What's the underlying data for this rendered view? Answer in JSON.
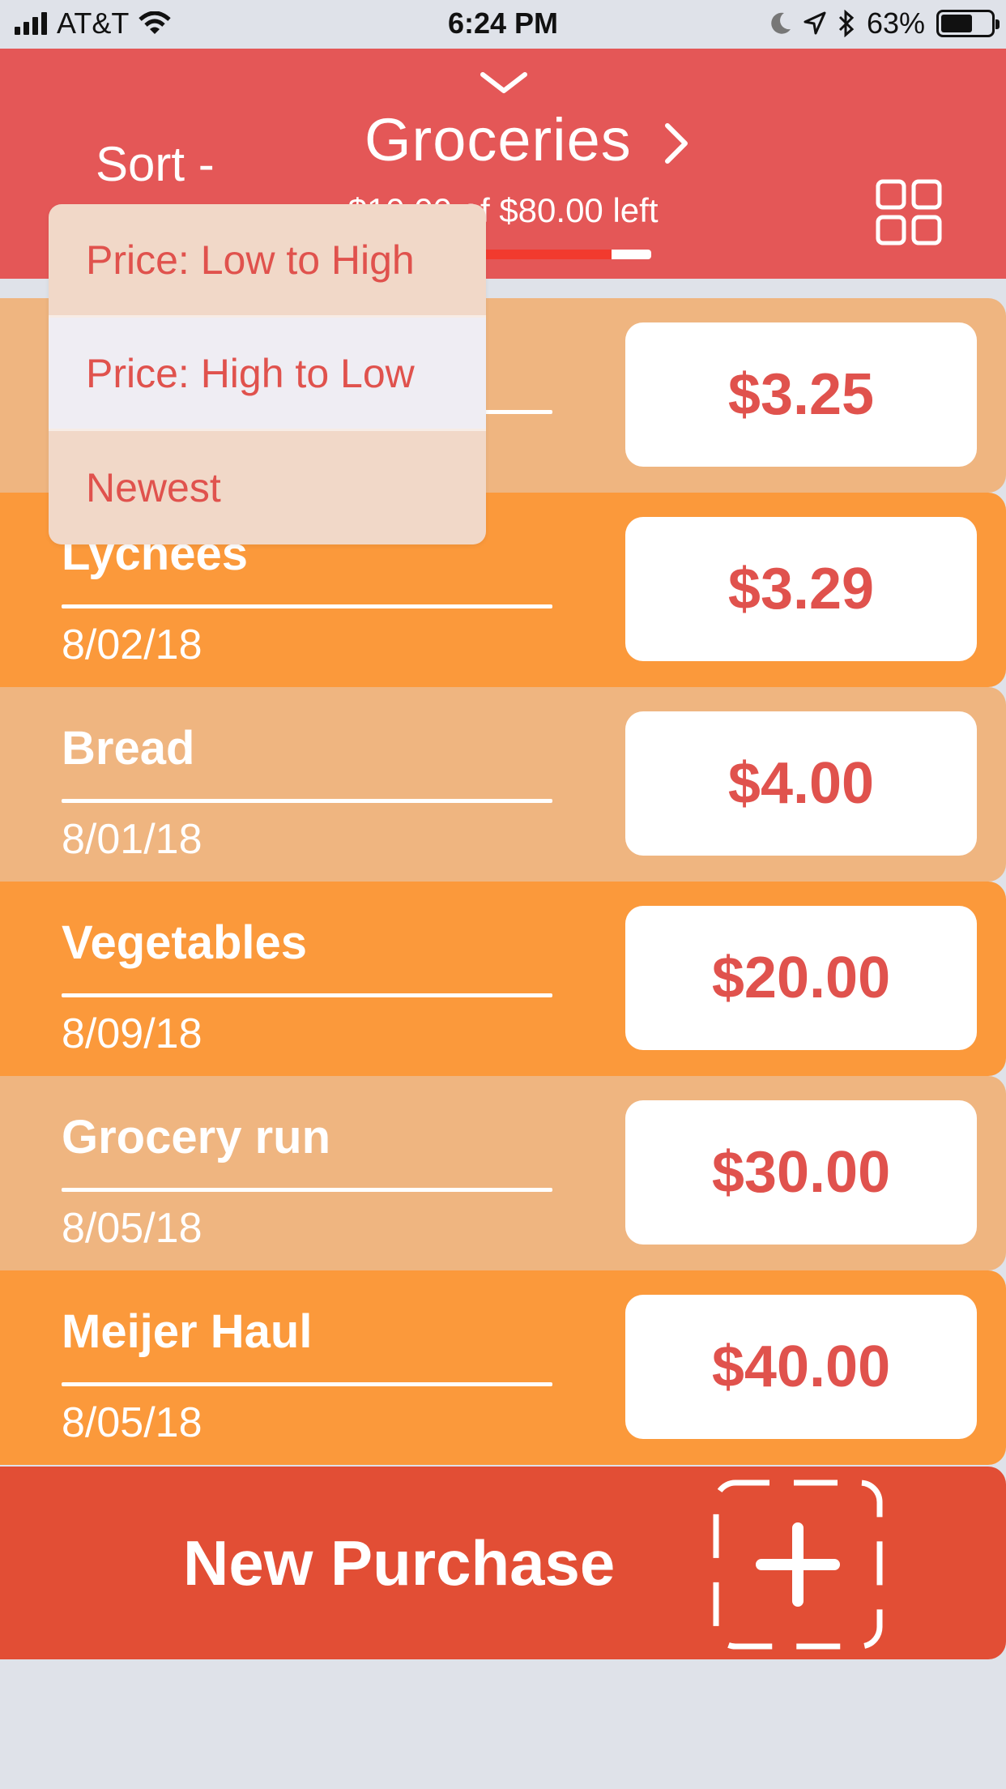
{
  "status_bar": {
    "carrier": "AT&T",
    "time": "6:24 PM",
    "battery_percent": "63%",
    "battery_level": 0.63,
    "icons": [
      "signal-icon",
      "wifi-icon",
      "moon-icon",
      "location-icon",
      "bluetooth-icon",
      "battery-icon"
    ]
  },
  "header": {
    "sort_label": "Sort -",
    "title": "Groceries",
    "budget_text": "$10.00 of $80.00 left",
    "budget_spent_fraction": 0.875,
    "icons": [
      "chevron-down-icon",
      "chevron-right-icon",
      "grid-view-icon"
    ]
  },
  "sort_menu": {
    "options": [
      "Price: Low to High",
      "Price: High to Low",
      "Newest"
    ],
    "highlighted": "Price: High to Low"
  },
  "purchases": [
    {
      "name": "",
      "date": "",
      "price": "$3.25"
    },
    {
      "name": "Lychees",
      "date": "8/02/18",
      "price": "$3.29"
    },
    {
      "name": "Bread",
      "date": "8/01/18",
      "price": "$4.00"
    },
    {
      "name": "Vegetables",
      "date": "8/09/18",
      "price": "$20.00"
    },
    {
      "name": "Grocery run",
      "date": "8/05/18",
      "price": "$30.00"
    },
    {
      "name": "Meijer Haul",
      "date": "8/05/18",
      "price": "$40.00"
    }
  ],
  "new_purchase": {
    "label": "New Purchase",
    "icon": "add-icon"
  },
  "colors": {
    "header": "#e45757",
    "row_light": "#efb580",
    "row_dark": "#fb993b",
    "price_text": "#e0524d",
    "new_purchase_bar": "#e24e35",
    "dropdown": "#f1d8c8",
    "background": "#dfe2e9"
  }
}
